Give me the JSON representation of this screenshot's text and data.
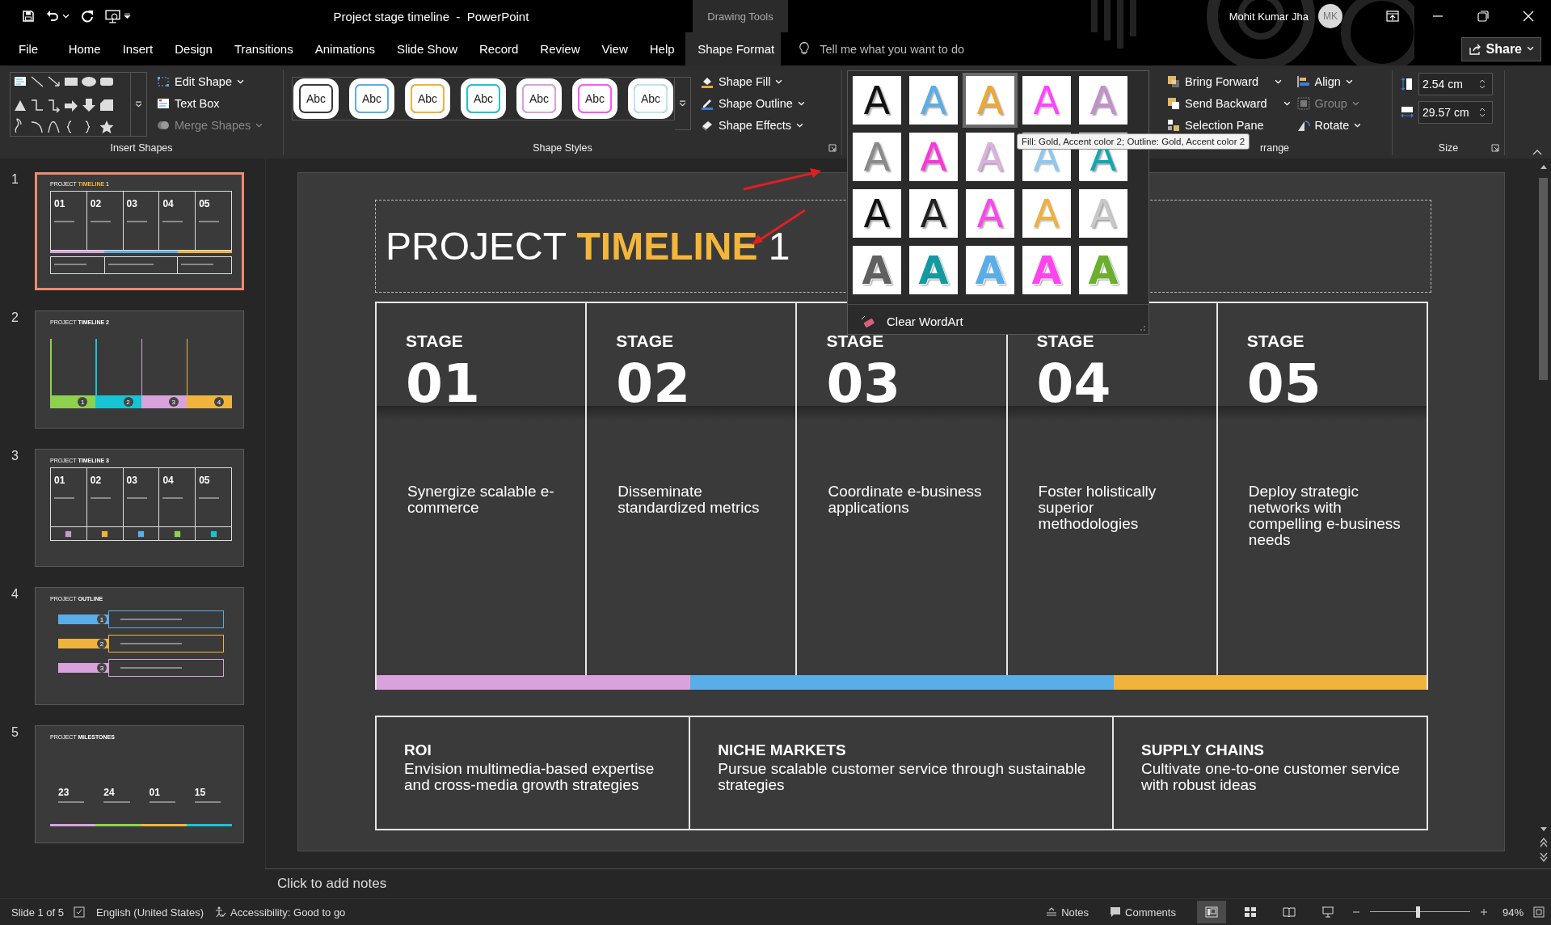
{
  "title_bar": {
    "document_title": "Project stage timeline  -  PowerPoint",
    "context_label": "Drawing Tools",
    "user": {
      "name": "Mohit Kumar Jha",
      "initials": "MK"
    }
  },
  "tabs": [
    {
      "label": "File",
      "selected": false
    },
    {
      "label": "Home",
      "selected": false
    },
    {
      "label": "Insert",
      "selected": false
    },
    {
      "label": "Design",
      "selected": false
    },
    {
      "label": "Transitions",
      "selected": false
    },
    {
      "label": "Animations",
      "selected": false
    },
    {
      "label": "Slide Show",
      "selected": false
    },
    {
      "label": "Record",
      "selected": false
    },
    {
      "label": "Review",
      "selected": false
    },
    {
      "label": "View",
      "selected": false
    },
    {
      "label": "Help",
      "selected": false
    },
    {
      "label": "Shape Format",
      "selected": true
    }
  ],
  "tell_me": {
    "placeholder": "Tell me what you want to do"
  },
  "share": {
    "label": "Share"
  },
  "ribbon": {
    "insert_shapes": {
      "label": "Insert Shapes",
      "commands": [
        {
          "label": "Edit Shape",
          "disabled": false,
          "dropdown": true
        },
        {
          "label": "Text Box",
          "disabled": false,
          "dropdown": false
        },
        {
          "label": "Merge Shapes",
          "disabled": true,
          "dropdown": true
        }
      ]
    },
    "shape_styles": {
      "label": "Shape Styles",
      "styles": [
        {
          "label": "Abc",
          "color": "#3a3a3a"
        },
        {
          "label": "Abc",
          "color": "#5aaee8"
        },
        {
          "label": "Abc",
          "color": "#f0b43c"
        },
        {
          "label": "Abc",
          "color": "#1ec6cf"
        },
        {
          "label": "Abc",
          "color": "#dca0e0"
        },
        {
          "label": "Abc",
          "color": "#ff55ff"
        },
        {
          "label": "Abc",
          "color": "#bfe6f2"
        }
      ],
      "commands": [
        {
          "label": "Shape Fill"
        },
        {
          "label": "Shape Outline"
        },
        {
          "label": "Shape Effects"
        }
      ]
    },
    "arrange": {
      "label": "rrange",
      "commands": [
        {
          "label": "Bring Forward",
          "disabled": false,
          "dropdown": true
        },
        {
          "label": "Send Backward",
          "disabled": false,
          "dropdown": true
        },
        {
          "label": "Selection Pane",
          "disabled": false,
          "dropdown": false
        },
        {
          "label": "Align",
          "disabled": false,
          "dropdown": true
        },
        {
          "label": "Group",
          "disabled": true,
          "dropdown": true
        },
        {
          "label": "Rotate",
          "disabled": false,
          "dropdown": true
        }
      ]
    },
    "size": {
      "label": "Size",
      "height": "2.54 cm",
      "width": "29.57 cm"
    }
  },
  "wordart_gallery": {
    "items": [
      {
        "label": "A",
        "color": "#111111",
        "kind": "solid",
        "selected": false
      },
      {
        "label": "A",
        "color": "#5aaee8",
        "kind": "solid",
        "selected": false
      },
      {
        "label": "A",
        "color": "#f0a830",
        "kind": "solid",
        "selected": true
      },
      {
        "label": "A",
        "color": "#ff44ff",
        "kind": "outline",
        "selected": false
      },
      {
        "label": "A",
        "color": "#c48fcc",
        "kind": "solid",
        "selected": false
      },
      {
        "label": "A",
        "color": "#8a8a8a",
        "kind": "solid",
        "selected": false
      },
      {
        "label": "A",
        "color": "#ff33dd",
        "kind": "solid",
        "selected": false
      },
      {
        "label": "A",
        "color": "#dcb0e0",
        "kind": "solid",
        "selected": false
      },
      {
        "label": "A",
        "color": "#8cc8f0",
        "kind": "outline",
        "selected": false
      },
      {
        "label": "A",
        "color": "#10a8b0",
        "kind": "solid",
        "selected": false
      },
      {
        "label": "A",
        "color": "#111111",
        "kind": "solid",
        "selected": false
      },
      {
        "label": "A",
        "color": "#222222",
        "kind": "solid",
        "selected": false
      },
      {
        "label": "A",
        "color": "#ff44ee",
        "kind": "solid",
        "selected": false
      },
      {
        "label": "A",
        "color": "#f0b040",
        "kind": "outline",
        "selected": false
      },
      {
        "label": "A",
        "color": "#c8c8c8",
        "kind": "solid",
        "selected": false
      },
      {
        "label": "A",
        "color": "#606060",
        "kind": "pattern",
        "selected": false
      },
      {
        "label": "A",
        "color": "#139aa0",
        "kind": "pattern",
        "selected": false
      },
      {
        "label": "A",
        "color": "#5aaee8",
        "kind": "pattern",
        "selected": false
      },
      {
        "label": "A",
        "color": "#ff44ee",
        "kind": "pattern",
        "selected": false
      },
      {
        "label": "A",
        "color": "#6ab02e",
        "kind": "pattern",
        "selected": false
      }
    ],
    "clear": "Clear WordArt"
  },
  "tooltip": "Fill: Gold, Accent color 2; Outline: Gold, Accent color 2",
  "slides_pane": {
    "slides": [
      {
        "number": "1",
        "selected": true,
        "kind": "stages",
        "title": [
          {
            "text": "PROJECT ",
            "kind": "plain"
          },
          {
            "text": "TIMELINE",
            "kind": "accent"
          },
          {
            "text": " 1",
            "kind": "plain"
          }
        ],
        "items": [
          {
            "label": "01"
          },
          {
            "label": "02"
          },
          {
            "label": "03"
          },
          {
            "label": "04"
          },
          {
            "label": "05"
          }
        ],
        "bars": [
          {
            "color": "#d9a2dc"
          },
          {
            "color": "#5aaee8"
          },
          {
            "color": "#f0b43c"
          }
        ]
      },
      {
        "number": "2",
        "selected": false,
        "kind": "timeline",
        "title": [
          {
            "text": "PROJECT ",
            "kind": "plain"
          },
          {
            "text": "TIMELINE 2",
            "kind": "bold"
          }
        ],
        "items": [
          {
            "label": "1",
            "color": "#8ed14f"
          },
          {
            "label": "2",
            "color": "#16c4d4"
          },
          {
            "label": "3",
            "color": "#d9a2dc"
          },
          {
            "label": "4",
            "color": "#f0b43c"
          }
        ]
      },
      {
        "number": "3",
        "selected": false,
        "kind": "stages_icons",
        "title": [
          {
            "text": "PROJECT ",
            "kind": "plain"
          },
          {
            "text": "TIMELINE 3",
            "kind": "bold"
          }
        ],
        "items": [
          {
            "label": "01",
            "color": "#c89ad0"
          },
          {
            "label": "02",
            "color": "#f0b43c"
          },
          {
            "label": "03",
            "color": "#5aaee8"
          },
          {
            "label": "04",
            "color": "#8ed14f"
          },
          {
            "label": "05",
            "color": "#16c4d4"
          }
        ]
      },
      {
        "number": "4",
        "selected": false,
        "kind": "outline",
        "title": [
          {
            "text": "PROJECT ",
            "kind": "plain"
          },
          {
            "text": "OUTLINE",
            "kind": "bold"
          }
        ],
        "items": [
          {
            "label": "1",
            "color": "#5aaee8"
          },
          {
            "label": "2",
            "color": "#f0b43c"
          },
          {
            "label": "3",
            "color": "#d9a2dc"
          }
        ]
      },
      {
        "number": "5",
        "selected": false,
        "kind": "milestones",
        "title": [
          {
            "text": "PROJECT ",
            "kind": "plain"
          },
          {
            "text": "MILESTONES",
            "kind": "bold"
          }
        ],
        "items": [
          {
            "label": "23",
            "color": "#d9a2dc"
          },
          {
            "label": "24",
            "color": "#8ed14f"
          },
          {
            "label": "01",
            "color": "#f0b43c"
          },
          {
            "label": "15",
            "color": "#16c4d4"
          }
        ]
      }
    ]
  },
  "slide": {
    "title": [
      {
        "text": "PROJECT ",
        "kind": "plain"
      },
      {
        "text": "TIMELINE",
        "kind": "accent"
      },
      {
        "text": " 1",
        "kind": "plain"
      }
    ],
    "stages": [
      {
        "label": "STAGE",
        "number": "01",
        "text": "Synergize scalable e-commerce"
      },
      {
        "label": "STAGE",
        "number": "02",
        "text": "Disseminate standardized metrics"
      },
      {
        "label": "STAGE",
        "number": "03",
        "text": "Coordinate e-business applications"
      },
      {
        "label": "STAGE",
        "number": "04",
        "text": "Foster holistically superior methodologies"
      },
      {
        "label": "STAGE",
        "number": "05",
        "text": "Deploy strategic networks with compelling e-business needs"
      }
    ],
    "summary": [
      {
        "heading": "ROI",
        "text": "Envision multimedia-based expertise and cross-media growth strategies",
        "color": "#d9a2dc"
      },
      {
        "heading": "NICHE MARKETS",
        "text": "Pursue scalable customer service through sustainable strategies",
        "color": "#5aaee8"
      },
      {
        "heading": "SUPPLY CHAINS",
        "text": "Cultivate one-to-one customer service with robust ideas",
        "color": "#f0b43c"
      }
    ]
  },
  "notes": {
    "placeholder": "Click to add notes"
  },
  "status_bar": {
    "slide": "Slide 1 of 5",
    "language": "English (United States)",
    "accessibility": "Accessibility: Good to go",
    "notes": "Notes",
    "comments": "Comments",
    "views": [
      {
        "selected": true
      },
      {
        "selected": false
      },
      {
        "selected": false
      },
      {
        "selected": false
      }
    ],
    "zoom": {
      "level": 0.48,
      "reading": "94%"
    }
  }
}
